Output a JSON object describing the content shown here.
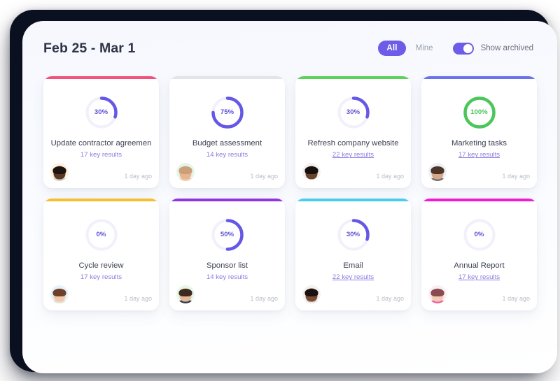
{
  "header": {
    "title": "Feb 25 - Mar 1",
    "filter_all": "All",
    "filter_mine": "Mine",
    "archived_label": "Show archived",
    "archived_toggle_state": "on"
  },
  "theme": {
    "accent_purple": "#6c5ce7",
    "ring_purple": "#6558e6",
    "ring_green": "#4cc65a",
    "ring_track": "#f1f0fb",
    "sub_link": "#8b7de0",
    "bezel": "#0b1020",
    "screen_bg": "#f8fafd"
  },
  "cards": [
    {
      "accent": "#f2537d",
      "percent": 30,
      "percent_label": "30%",
      "ring_color": "#6558e6",
      "title": "Update contractor agreemen",
      "results": "17 key results",
      "results_underlined": false,
      "timestamp": "1 day ago",
      "avatar": {
        "bg": "#fdf3df",
        "skin": "#5a3824",
        "hair": "#1d1410",
        "shirt": "#d8d3cb"
      }
    },
    {
      "accent": "#e3e4e8",
      "percent": 75,
      "percent_label": "75%",
      "ring_color": "#6558e6",
      "title": "Budget assessment",
      "results": "14 key results",
      "results_underlined": false,
      "timestamp": "1 day ago",
      "avatar": {
        "bg": "#e5f5e8",
        "skin": "#e8b48f",
        "hair": "#caa07a",
        "shirt": "#f0cdb4"
      }
    },
    {
      "accent": "#5ed15a",
      "percent": 30,
      "percent_label": "30%",
      "ring_color": "#6558e6",
      "title": "Refresh company website",
      "results": "22 key results",
      "results_underlined": true,
      "timestamp": "1 day ago",
      "avatar": {
        "bg": "#f2f1f0",
        "skin": "#6b422c",
        "hair": "#150f0d",
        "shirt": "#ffffff"
      }
    },
    {
      "accent": "#6b73ea",
      "percent": 100,
      "percent_label": "100%",
      "ring_color": "#4cc65a",
      "title": "Marketing tasks",
      "results": "17 key results",
      "results_underlined": true,
      "timestamp": "1 day ago",
      "avatar": {
        "bg": "#eef0f4",
        "skin": "#d9a887",
        "hair": "#4b3428",
        "shirt": "#6f6f75"
      }
    },
    {
      "accent": "#f7bf2e",
      "percent": 0,
      "percent_label": "0%",
      "ring_color": "#6558e6",
      "title": "Cycle review",
      "results": "17 key results",
      "results_underlined": false,
      "timestamp": "1 day ago",
      "avatar": {
        "bg": "#e6f3fb",
        "skin": "#f0c9ad",
        "hair": "#6e3f2c",
        "shirt": "#e8dfd6"
      }
    },
    {
      "accent": "#9135e0",
      "percent": 50,
      "percent_label": "50%",
      "ring_color": "#6558e6",
      "title": "Sponsor list",
      "results": "14 key results",
      "results_underlined": false,
      "timestamp": "1 day ago",
      "avatar": {
        "bg": "#e8f6ea",
        "skin": "#e5b897",
        "hair": "#3c2a1e",
        "shirt": "#2f3a4a"
      }
    },
    {
      "accent": "#48cdec",
      "percent": 30,
      "percent_label": "30%",
      "ring_color": "#6558e6",
      "title": "Email",
      "results": "22 key results",
      "results_underlined": true,
      "timestamp": "1 day ago",
      "avatar": {
        "bg": "#f4f1ee",
        "skin": "#7a4c33",
        "hair": "#1a1210",
        "shirt": "#e9e4df"
      }
    },
    {
      "accent": "#f21ad3",
      "percent": 0,
      "percent_label": "0%",
      "ring_color": "#6558e6",
      "title": "Annual Report",
      "results": "17 key results",
      "results_underlined": true,
      "timestamp": "1 day ago",
      "avatar": {
        "bg": "#fbeef3",
        "skin": "#f0cdb4",
        "hair": "#8a4a52",
        "shirt": "#ef5fa0"
      }
    }
  ]
}
